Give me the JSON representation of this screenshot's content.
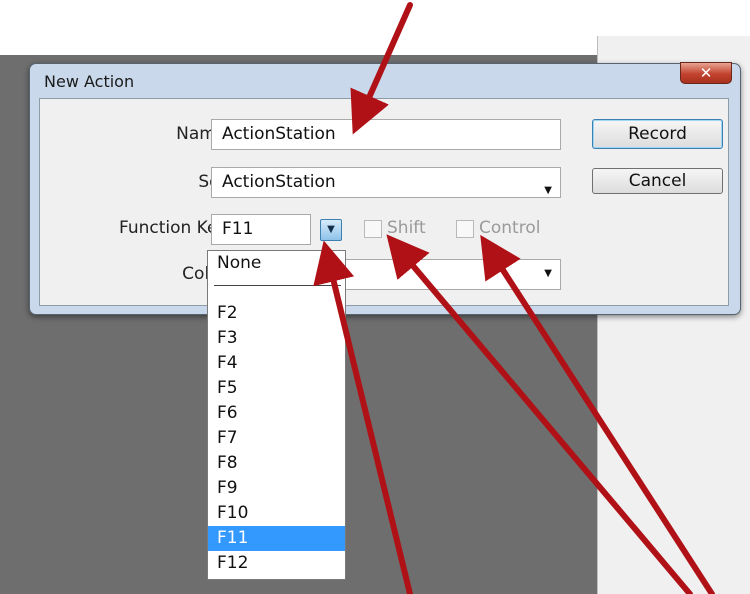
{
  "dialog": {
    "title": "New Action",
    "close_glyph": "✕",
    "name_label": "Name:",
    "name_value": "ActionStation",
    "set_label": "Set:",
    "set_value": "ActionStation",
    "function_key_label": "Function Key:",
    "function_key_value": "F11",
    "shift_label": "Shift",
    "shift_checked": false,
    "control_label": "Control",
    "control_checked": false,
    "color_label": "Color:",
    "record_label": "Record",
    "cancel_label": "Cancel"
  },
  "dropdown": {
    "first_item": "None",
    "items": [
      "F2",
      "F3",
      "F4",
      "F5",
      "F6",
      "F7",
      "F8",
      "F9",
      "F10",
      "F11",
      "F12"
    ],
    "selected": "F11"
  },
  "annotation_arrow_color": "#b01116"
}
